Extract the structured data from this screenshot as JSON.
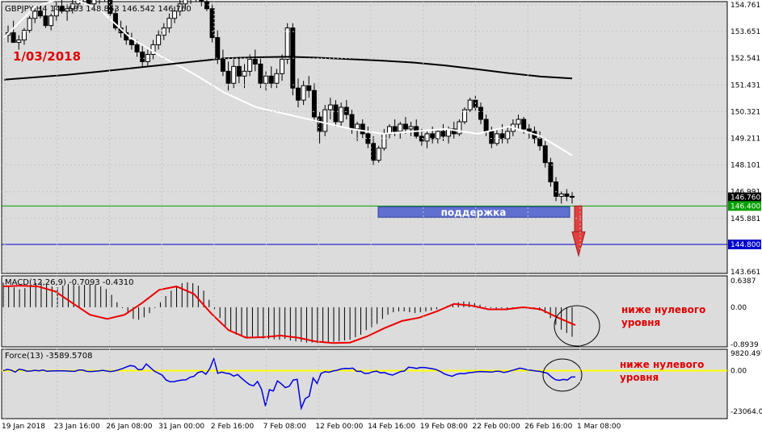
{
  "symbol_header": "GBPJPY,H4  148.683 148.863 146.542 146.760",
  "date_label": "1/03/2018",
  "support_label": "поддержка",
  "macd_header": "MACD(12,26,9) -0.7093 -0.4310",
  "force_header": "Force(13) -3589.5708",
  "macd_annotation": [
    "ниже нулевого",
    "уровня"
  ],
  "force_annotation": [
    "ниже нулевого",
    "уровня"
  ],
  "colors": {
    "background": "#dcdcdc",
    "panel_border": "#000000",
    "support_line": "#00a000",
    "target_line": "#0000cc",
    "support_box": "#6070d0",
    "arrow": "#e04040",
    "annotation_text": "#e00000",
    "signal_line": "#ee0000",
    "force_line": "#0000dd",
    "force_zero": "#ffff00",
    "ma_fast": "#ffffff",
    "ma_slow": "#000000"
  },
  "chart_data": [
    {
      "type": "candlestick",
      "panel": "price",
      "ylim": [
        143.661,
        154.761
      ],
      "y_ticks": [
        "154.761",
        "153.651",
        "152.541",
        "151.431",
        "150.321",
        "149.211",
        "148.101",
        "146.991",
        "145.881",
        "144.800",
        "143.661"
      ],
      "x_ticks": [
        "19 Jan 2018",
        "23 Jan 16:00",
        "26 Jan 08:00",
        "31 Jan 00:00",
        "2 Feb 16:00",
        "7 Feb 08:00",
        "12 Feb 00:00",
        "14 Feb 16:00",
        "19 Feb 08:00",
        "22 Feb 00:00",
        "26 Feb 16:00",
        "1 Mar 08:00"
      ],
      "current_price": 146.76,
      "levels": [
        {
          "name": "support",
          "value": 146.4
        },
        {
          "name": "target",
          "value": 144.8
        }
      ],
      "ohlc": [
        [
          153.5,
          153.9,
          153.2,
          153.6
        ],
        [
          153.6,
          154.1,
          153.4,
          153.2
        ],
        [
          153.2,
          153.5,
          152.9,
          153.3
        ],
        [
          153.3,
          153.8,
          153.1,
          153.7
        ],
        [
          153.7,
          154.3,
          153.6,
          154.2
        ],
        [
          154.2,
          154.7,
          154.0,
          154.5
        ],
        [
          154.5,
          154.8,
          154.2,
          154.3
        ],
        [
          154.3,
          154.6,
          153.8,
          153.9
        ],
        [
          153.9,
          154.4,
          153.7,
          154.3
        ],
        [
          154.3,
          154.9,
          154.1,
          154.7
        ],
        [
          154.7,
          155.0,
          154.4,
          154.5
        ],
        [
          154.5,
          154.8,
          154.1,
          154.6
        ],
        [
          154.6,
          155.0,
          154.4,
          154.8
        ],
        [
          154.8,
          155.2,
          154.6,
          155.0
        ],
        [
          155.0,
          155.3,
          154.8,
          155.1
        ],
        [
          155.1,
          155.3,
          154.7,
          154.8
        ],
        [
          154.8,
          155.2,
          154.6,
          155.0
        ],
        [
          155.0,
          155.3,
          154.8,
          155.2
        ],
        [
          155.2,
          155.4,
          154.9,
          155.0
        ],
        [
          155.0,
          155.2,
          154.3,
          154.4
        ],
        [
          154.4,
          154.6,
          153.7,
          153.8
        ],
        [
          153.8,
          154.1,
          153.4,
          153.6
        ],
        [
          153.6,
          153.9,
          153.1,
          153.3
        ],
        [
          153.3,
          153.6,
          152.9,
          153.1
        ],
        [
          153.1,
          153.3,
          152.6,
          152.8
        ],
        [
          152.8,
          153.1,
          152.2,
          152.4
        ],
        [
          152.4,
          152.9,
          152.2,
          152.7
        ],
        [
          152.7,
          153.3,
          152.5,
          153.1
        ],
        [
          153.1,
          153.7,
          152.9,
          153.5
        ],
        [
          153.5,
          154.0,
          153.3,
          153.8
        ],
        [
          153.8,
          154.4,
          153.6,
          154.2
        ],
        [
          154.2,
          154.7,
          154.0,
          154.5
        ],
        [
          154.5,
          155.0,
          154.3,
          154.8
        ],
        [
          154.8,
          155.2,
          154.6,
          155.0
        ],
        [
          155.0,
          155.4,
          154.8,
          155.2
        ],
        [
          155.2,
          155.5,
          154.9,
          155.1
        ],
        [
          155.1,
          155.3,
          154.7,
          154.9
        ],
        [
          154.9,
          155.2,
          154.5,
          154.6
        ],
        [
          154.6,
          154.8,
          153.2,
          153.4
        ],
        [
          153.4,
          153.7,
          152.3,
          152.5
        ],
        [
          152.5,
          152.9,
          151.8,
          152.0
        ],
        [
          152.0,
          152.4,
          151.2,
          151.5
        ],
        [
          151.5,
          152.5,
          151.3,
          152.2
        ],
        [
          152.2,
          152.6,
          151.5,
          151.8
        ],
        [
          151.8,
          152.3,
          151.3,
          152.0
        ],
        [
          152.0,
          152.7,
          151.8,
          152.5
        ],
        [
          152.5,
          152.9,
          152.0,
          152.3
        ],
        [
          152.3,
          152.6,
          151.3,
          151.5
        ],
        [
          151.5,
          152.0,
          151.2,
          151.8
        ],
        [
          151.8,
          152.2,
          151.3,
          151.5
        ],
        [
          151.5,
          152.1,
          151.3,
          151.9
        ],
        [
          151.9,
          152.7,
          151.6,
          152.5
        ],
        [
          152.5,
          154.0,
          152.3,
          153.8
        ],
        [
          153.8,
          154.0,
          151.0,
          151.3
        ],
        [
          151.3,
          151.7,
          150.5,
          150.8
        ],
        [
          150.8,
          151.6,
          150.6,
          151.4
        ],
        [
          151.4,
          151.8,
          150.9,
          151.2
        ],
        [
          151.2,
          151.5,
          149.9,
          150.1
        ],
        [
          150.1,
          150.3,
          149.0,
          149.5
        ],
        [
          149.5,
          150.6,
          149.3,
          150.4
        ],
        [
          150.4,
          150.9,
          150.0,
          150.6
        ],
        [
          150.6,
          150.8,
          149.7,
          149.9
        ],
        [
          149.9,
          150.7,
          149.7,
          150.5
        ],
        [
          150.5,
          150.8,
          150.0,
          150.2
        ],
        [
          150.2,
          150.4,
          149.4,
          149.6
        ],
        [
          149.6,
          149.9,
          149.1,
          149.8
        ],
        [
          149.8,
          150.0,
          149.2,
          149.4
        ],
        [
          149.4,
          149.7,
          148.8,
          149.0
        ],
        [
          149.0,
          149.3,
          148.1,
          148.3
        ],
        [
          148.3,
          148.9,
          148.2,
          148.8
        ],
        [
          148.8,
          149.6,
          148.7,
          149.4
        ],
        [
          149.4,
          149.8,
          149.2,
          149.7
        ],
        [
          149.7,
          150.0,
          149.3,
          149.5
        ],
        [
          149.5,
          149.9,
          149.2,
          149.8
        ],
        [
          149.8,
          150.1,
          149.4,
          149.6
        ],
        [
          149.6,
          149.9,
          149.3,
          149.7
        ],
        [
          149.7,
          150.0,
          149.2,
          149.3
        ],
        [
          149.3,
          149.6,
          148.9,
          149.1
        ],
        [
          149.1,
          149.5,
          148.8,
          149.4
        ],
        [
          149.4,
          149.7,
          149.0,
          149.2
        ],
        [
          149.2,
          149.6,
          149.0,
          149.5
        ],
        [
          149.5,
          149.8,
          149.1,
          149.3
        ],
        [
          149.3,
          149.7,
          149.0,
          149.6
        ],
        [
          149.6,
          149.9,
          149.2,
          149.4
        ],
        [
          149.4,
          150.0,
          149.3,
          149.9
        ],
        [
          149.9,
          150.5,
          149.8,
          150.4
        ],
        [
          150.4,
          150.9,
          150.3,
          150.8
        ],
        [
          150.8,
          151.0,
          150.3,
          150.5
        ],
        [
          150.5,
          150.7,
          149.8,
          150.0
        ],
        [
          150.0,
          150.2,
          149.3,
          149.5
        ],
        [
          149.5,
          149.7,
          148.8,
          149.0
        ],
        [
          149.0,
          149.6,
          148.9,
          149.4
        ],
        [
          149.4,
          149.8,
          149.0,
          149.2
        ],
        [
          149.2,
          149.7,
          149.0,
          149.5
        ],
        [
          149.5,
          150.0,
          149.3,
          149.8
        ],
        [
          149.8,
          150.2,
          149.6,
          150.0
        ],
        [
          150.0,
          150.1,
          149.4,
          149.6
        ],
        [
          149.6,
          149.8,
          149.2,
          149.5
        ],
        [
          149.5,
          149.7,
          149.0,
          149.2
        ],
        [
          149.2,
          149.5,
          148.7,
          148.9
        ],
        [
          148.9,
          149.1,
          148.0,
          148.2
        ],
        [
          148.2,
          148.4,
          147.2,
          147.4
        ],
        [
          147.4,
          147.6,
          146.6,
          146.8
        ],
        [
          146.8,
          147.0,
          146.5,
          146.9
        ],
        [
          146.9,
          147.1,
          146.6,
          146.8
        ],
        [
          146.8,
          147.0,
          146.5,
          146.76
        ]
      ],
      "ma_fast": {
        "color": "white",
        "values": [
          153.4,
          154.7,
          155.1,
          154.6,
          153.4,
          152.6,
          151.9,
          151.1,
          150.5,
          150.2,
          149.9,
          149.6,
          149.4,
          149.5,
          149.6,
          149.4,
          149.7,
          149.3,
          148.5
        ]
      },
      "ma_slow": {
        "color": "black",
        "values": [
          151.65,
          151.75,
          151.85,
          151.98,
          152.12,
          152.26,
          152.4,
          152.54,
          152.58,
          152.6,
          152.56,
          152.5,
          152.44,
          152.36,
          152.24,
          152.08,
          151.92,
          151.78,
          151.7
        ]
      }
    },
    {
      "type": "histogram",
      "panel": "macd",
      "name": "MACD(12,26,9)",
      "ylim": [
        -0.8939,
        0.6387
      ],
      "y_ticks": [
        "0.6387",
        "0.00",
        "-0.8939"
      ],
      "values": [
        0.59,
        0.52,
        0.48,
        0.43,
        0.46,
        0.52,
        0.58,
        0.6,
        0.56,
        0.5,
        0.48,
        0.52,
        0.56,
        0.54,
        0.52,
        0.54,
        0.56,
        0.54,
        0.5,
        0.44,
        0.3,
        0.12,
        -0.02,
        -0.15,
        -0.28,
        -0.3,
        -0.24,
        -0.14,
        -0.02,
        0.12,
        0.27,
        0.4,
        0.52,
        0.58,
        0.6,
        0.58,
        0.52,
        0.4,
        0.18,
        -0.05,
        -0.26,
        -0.45,
        -0.58,
        -0.66,
        -0.7,
        -0.72,
        -0.72,
        -0.74,
        -0.75,
        -0.76,
        -0.77,
        -0.78,
        -0.76,
        -0.8,
        -0.82,
        -0.83,
        -0.85,
        -0.85,
        -0.86,
        -0.85,
        -0.84,
        -0.83,
        -0.82,
        -0.8,
        -0.78,
        -0.72,
        -0.66,
        -0.55,
        -0.48,
        -0.4,
        -0.28,
        -0.18,
        -0.12,
        -0.1,
        -0.1,
        -0.12,
        -0.14,
        -0.12,
        -0.1,
        -0.08,
        -0.05,
        0.0,
        0.04,
        0.08,
        0.12,
        0.14,
        0.13,
        0.1,
        0.06,
        0.02,
        -0.02,
        -0.04,
        -0.02,
        -0.04,
        -0.03,
        -0.02,
        -0.03,
        -0.03,
        -0.05,
        -0.08,
        -0.14,
        -0.26,
        -0.42,
        -0.54,
        -0.62,
        -0.71
      ],
      "signal": {
        "color": "red",
        "values": [
          0.5,
          0.52,
          0.5,
          0.38,
          0.1,
          -0.18,
          -0.28,
          -0.18,
          0.1,
          0.42,
          0.5,
          0.32,
          -0.15,
          -0.55,
          -0.73,
          -0.72,
          -0.68,
          -0.73,
          -0.82,
          -0.86,
          -0.85,
          -0.7,
          -0.5,
          -0.33,
          -0.25,
          -0.1,
          0.08,
          0.04,
          -0.05,
          -0.05,
          0.0,
          -0.05,
          -0.25,
          -0.43
        ]
      }
    },
    {
      "type": "line",
      "panel": "force",
      "name": "Force(13)",
      "ylim": [
        -23064,
        9820.497
      ],
      "y_ticks": [
        "9820.4970",
        "0.00",
        "-23064.00"
      ],
      "values": [
        0,
        700,
        300,
        -800,
        800,
        400,
        -300,
        -200,
        200,
        -100,
        300,
        -300,
        -200,
        -150,
        -100,
        -150,
        -200,
        -300,
        -400,
        300,
        300,
        -400,
        -500,
        -300,
        -200,
        200,
        -200,
        -500,
        -200,
        400,
        1200,
        2100,
        2900,
        2500,
        500,
        700,
        3800,
        1800,
        -200,
        -1400,
        -2500,
        -5300,
        -6300,
        -6200,
        -5700,
        -5300,
        -5200,
        -3800,
        -3200,
        -1100,
        -400,
        -2000,
        1200,
        6800,
        -1500,
        -800,
        -1400,
        -1800,
        -3100,
        -2200,
        -4300,
        -6200,
        -7900,
        -8600,
        -6100,
        -10500,
        -20100,
        -10800,
        -11500,
        -5800,
        -7500,
        -9600,
        -8800,
        -5300,
        -5000,
        -21300,
        -15900,
        -14500,
        -4200,
        -7200,
        -1600,
        -600,
        -900,
        -200,
        200,
        900,
        1300,
        1200,
        1400,
        -400,
        -300,
        -1600,
        -1500,
        -600,
        -300,
        -1300,
        -1100,
        -2000,
        -2500,
        -1500,
        -500,
        -200,
        1900,
        1700,
        1300,
        1800,
        1800,
        1400,
        1100,
        600,
        -400,
        -1800,
        -2600,
        -3200,
        -2100,
        -1600,
        -1800,
        -1300,
        -1000,
        -700,
        -500,
        -600,
        -700,
        -800,
        -300,
        -400,
        -1000,
        -600,
        100,
        700,
        1400,
        1000,
        400,
        200,
        -200,
        -400,
        -900,
        -1500,
        -3600,
        -5100,
        -5500,
        -5000,
        -5300,
        -3600,
        -3600
      ]
    }
  ]
}
